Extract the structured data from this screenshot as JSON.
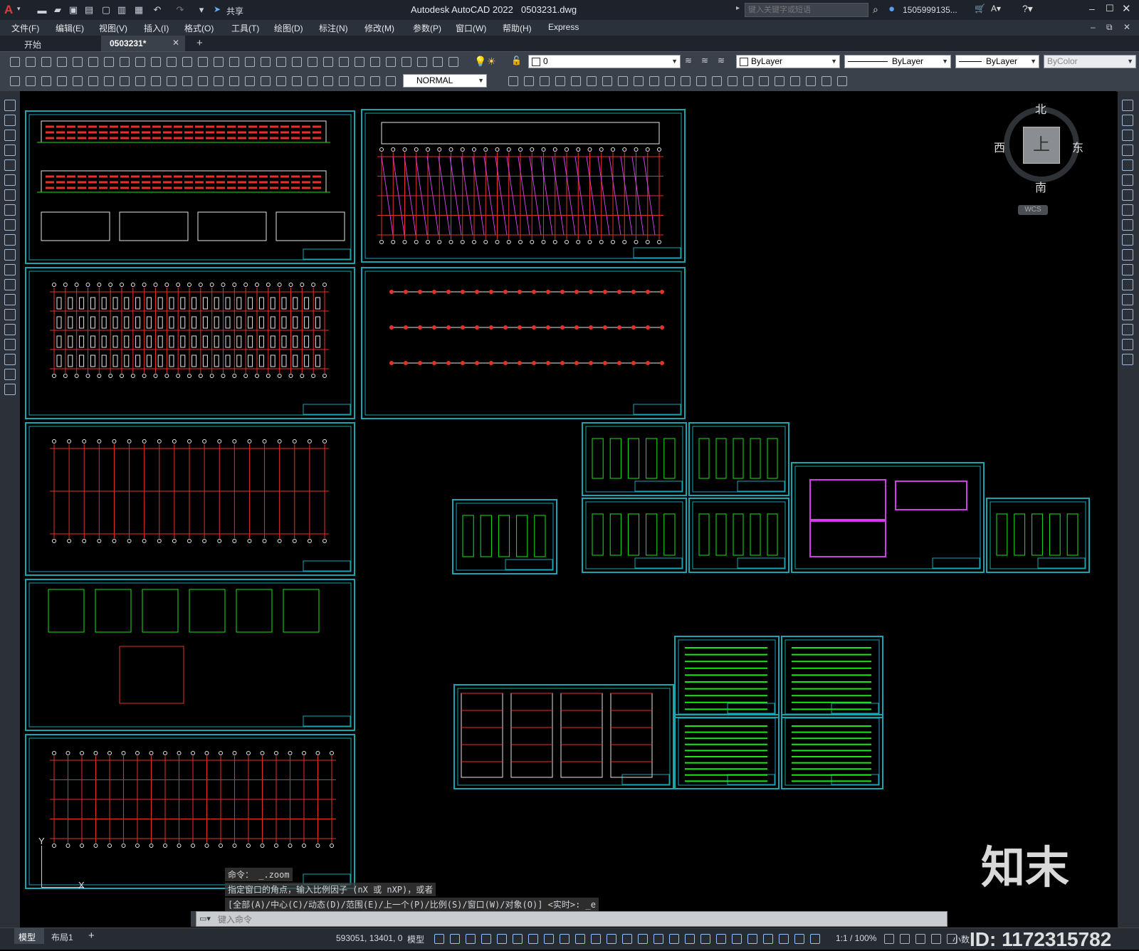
{
  "app": {
    "logo": "A",
    "title": "Autodesk AutoCAD 2022",
    "filename": "0503231.dwg",
    "share_label": "共享",
    "search_placeholder": "键入关键字或短语",
    "user": "1505999135...",
    "window_controls": [
      "minimize-icon",
      "maximize-icon",
      "close-icon"
    ]
  },
  "menu": {
    "items": [
      "文件(F)",
      "编辑(E)",
      "视图(V)",
      "插入(I)",
      "格式(O)",
      "工具(T)",
      "绘图(D)",
      "标注(N)",
      "修改(M)",
      "参数(P)",
      "窗口(W)",
      "帮助(H)",
      "Express"
    ]
  },
  "tabs": {
    "items": [
      "开始",
      "0503231*"
    ],
    "add": "+"
  },
  "ribbon": {
    "layer_value": "0",
    "color_value": "ByLayer",
    "linetype_value": "ByLayer",
    "lineweight_value": "ByLayer",
    "plotstyle_value": "ByColor",
    "dimstyle_value": "NORMAL"
  },
  "viewcube": {
    "north": "北",
    "south": "南",
    "east": "东",
    "west": "西",
    "top": "上",
    "wcs": "WCS"
  },
  "command": {
    "line1": "命令： _.zoom",
    "line2": "指定窗口的角点，输入比例因子 (nX 或 nXP)，或者",
    "line3": "[全部(A)/中心(C)/动态(D)/范围(E)/上一个(P)/比例(S)/窗口(W)/对象(O)] <实时>: _e",
    "placeholder": "键入命令"
  },
  "ucs": {
    "x": "X",
    "y": "Y"
  },
  "layout_tabs": {
    "model": "模型",
    "layout1": "布局1",
    "add": "+"
  },
  "status": {
    "coords": "593051, 13401, 0",
    "space": "模型",
    "scale": "1:1 / 100%",
    "units": "小数"
  },
  "watermark": {
    "brand": "知末",
    "id": "ID: 1172315782"
  },
  "colors": {
    "sheet_frame": "#1aa3b0",
    "line_green": "#19e619",
    "line_red": "#e8302a",
    "line_magenta": "#d23ce8",
    "line_white": "#e6e6e6"
  }
}
